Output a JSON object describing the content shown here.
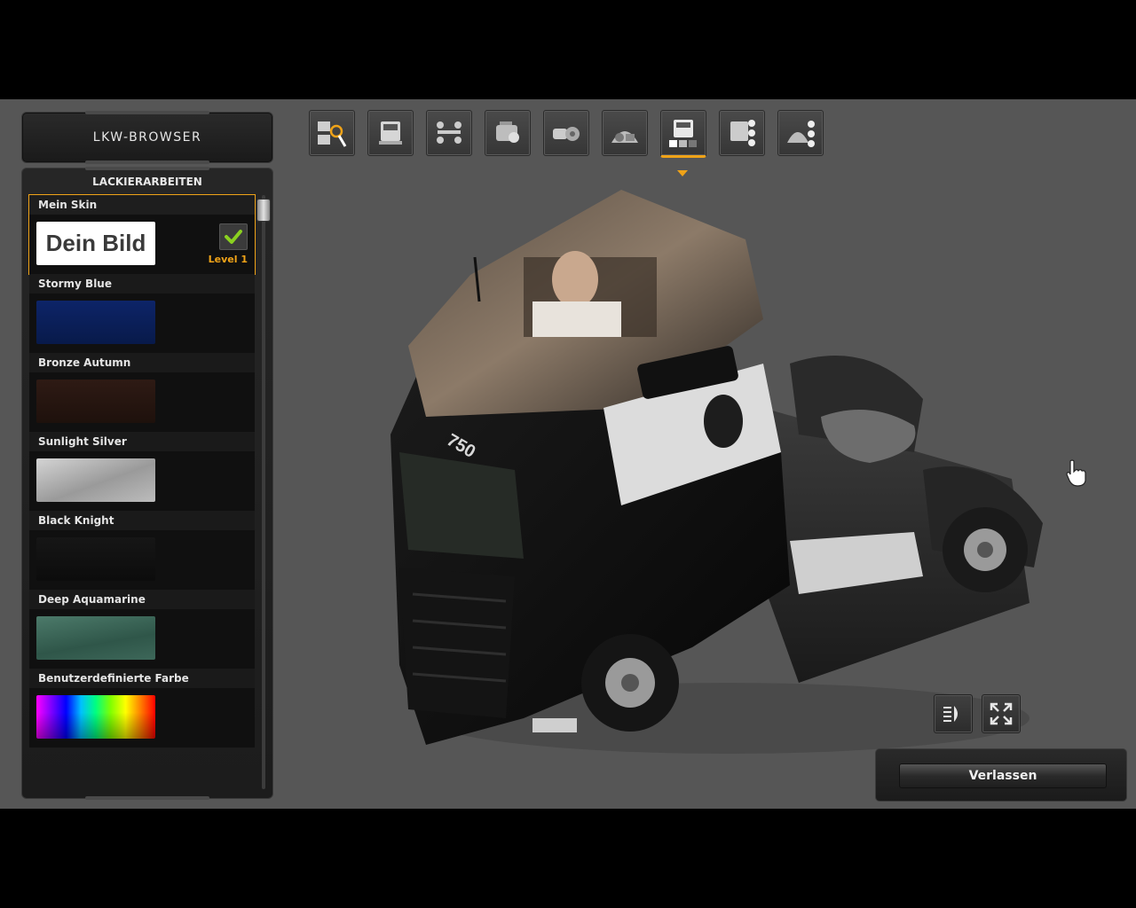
{
  "header": {
    "title": "LKW-BROWSER"
  },
  "paint_panel": {
    "title": "LACKIERARBEITEN",
    "items": [
      {
        "label": "Mein Skin",
        "swatch_text": "Dein Bild",
        "level": "Level 1",
        "selected": true
      },
      {
        "label": "Stormy Blue",
        "color": "#0b1f55"
      },
      {
        "label": "Bronze Autumn",
        "color": "#2a1712"
      },
      {
        "label": "Sunlight Silver",
        "color": "#a8a8a8"
      },
      {
        "label": "Black Knight",
        "color": "#111111"
      },
      {
        "label": "Deep Aquamarine",
        "color": "#3e6a5c"
      },
      {
        "label": "Benutzerdefinierte Farbe",
        "color": "rainbow"
      }
    ]
  },
  "toolbar": {
    "icons": [
      "truck-search-icon",
      "truck-icon",
      "chassis-icon",
      "engine-icon",
      "transmission-icon",
      "cabin-interior-icon",
      "paint-job-icon",
      "accessories-icon",
      "interior-accessories-icon"
    ],
    "active_index": 6
  },
  "controls": {
    "lights_icon": "headlights-icon",
    "fullscreen_icon": "fullscreen-icon",
    "exit_label": "Verlassen"
  },
  "truck": {
    "model_badge": "750"
  },
  "colors": {
    "accent": "#f0a318",
    "background": "#565656"
  }
}
